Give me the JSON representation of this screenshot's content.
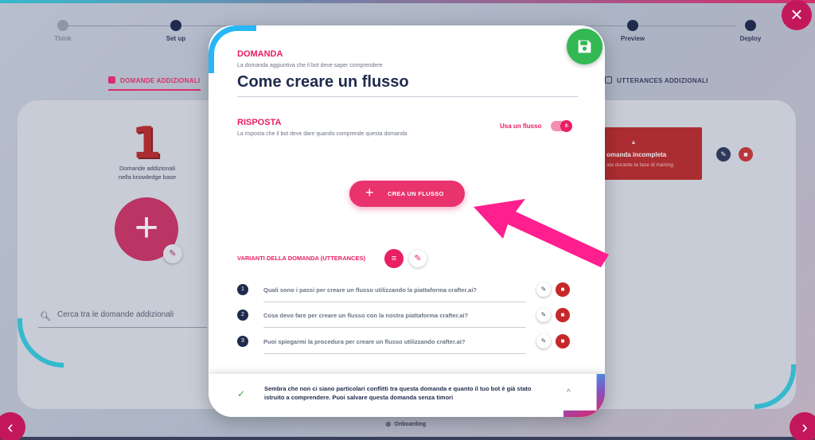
{
  "background": {
    "steps": [
      {
        "label": "Think",
        "state": "done"
      },
      {
        "label": "Set up",
        "state": "active"
      },
      {
        "label": "Preview",
        "state": "active"
      },
      {
        "label": "Deploy",
        "state": "active"
      }
    ],
    "tabs": {
      "left": "DOMANDE ADDIZIONALI",
      "right": "UTTERANCES ADDIZIONALI"
    },
    "count_number": "1",
    "count_caption_1": "Domande addizionali",
    "count_caption_2": "nella knowledge base",
    "search_placeholder": "Cerca tra le domande addizionali",
    "warning_card": {
      "title": "omanda incompleta",
      "text": "ata durante la fase di training."
    },
    "onboarding": "Onboarding"
  },
  "modal": {
    "question_label": "DOMANDA",
    "question_sub": "La domanda aggiuntiva che il bot deve saper comprendere",
    "question_title": "Come creare un flusso",
    "answer_label": "RISPOSTA",
    "answer_sub": "La risposta che il bot deve dare quando comprende questa domanda",
    "use_flow_label": "Usa un flusso",
    "use_flow_on": true,
    "create_flow_button": "CREA UN FLUSSO",
    "variants_label": "VARIANTI DELLA DOMANDA (UTTERANCES)",
    "utterances": [
      {
        "num": "1",
        "text": "Quali sono i passi per creare un flusso utilizzando la piattaforma crafter.ai?"
      },
      {
        "num": "2",
        "text": "Cosa devo fare per creare un flusso con la nostra piattaforma crafter.ai?"
      },
      {
        "num": "3",
        "text": "Puoi spiegarmi la procedura per creare un flusso utilizzando crafter.ai?"
      }
    ],
    "notice": {
      "message": "Sembra che non ci siano particolari conflitti tra questa domanda e quanto il tuo bot è già stato istruito a comprendere. Puoi salvare questa domanda senza timori"
    }
  },
  "colors": {
    "accent": "#e91e63",
    "navy": "#1f2b4d",
    "save_green": "#33b854",
    "delete_red": "#c62828"
  }
}
